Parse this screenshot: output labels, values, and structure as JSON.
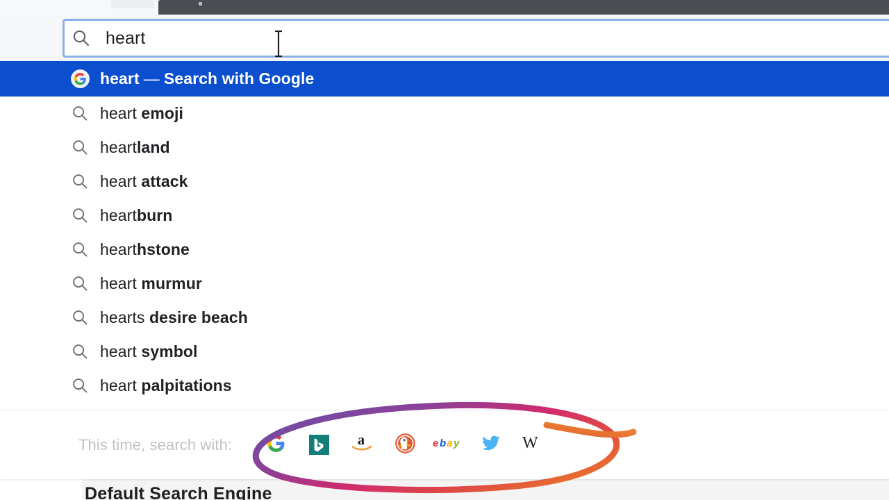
{
  "window": {
    "title_bar_color": "#4a4d52",
    "focus_ring_color": "#8ab0e8"
  },
  "omnibox": {
    "icon": "search-icon",
    "value": "heart",
    "placeholder": "Search or enter address",
    "caret_icon": "text-caret-icon"
  },
  "suggestions": {
    "selected_index": 0,
    "selected_bg": "#0B4ECE",
    "items": [
      {
        "icon": "google-icon",
        "typed": "heart",
        "dash": "—",
        "engine_text": "Search with Google",
        "completion": "",
        "selected": true
      },
      {
        "icon": "search-icon",
        "typed": "heart",
        "completion": " emoji",
        "selected": false
      },
      {
        "icon": "search-icon",
        "typed": "heart",
        "completion": "land",
        "selected": false
      },
      {
        "icon": "search-icon",
        "typed": "heart",
        "completion": " attack",
        "selected": false
      },
      {
        "icon": "search-icon",
        "typed": "heart",
        "completion": "burn",
        "selected": false
      },
      {
        "icon": "search-icon",
        "typed": "heart",
        "completion": "hstone",
        "selected": false
      },
      {
        "icon": "search-icon",
        "typed": "heart",
        "completion": " murmur",
        "selected": false
      },
      {
        "icon": "search-icon",
        "typed": "hearts",
        "completion": " desire beach",
        "selected": false
      },
      {
        "icon": "search-icon",
        "typed": "heart",
        "completion": " symbol",
        "selected": false
      },
      {
        "icon": "search-icon",
        "typed": "heart",
        "completion": " palpitations",
        "selected": false
      }
    ]
  },
  "engine_bar": {
    "label": "This time, search with:",
    "label_color": "#bfc2c6",
    "engines": [
      {
        "name": "Google",
        "icon": "google-icon"
      },
      {
        "name": "Bing",
        "icon": "bing-icon",
        "color": "#147d7a"
      },
      {
        "name": "Amazon",
        "icon": "amazon-icon",
        "color": "#f0a03c"
      },
      {
        "name": "DuckDuckGo",
        "icon": "duckduckgo-icon",
        "color": "#de5833"
      },
      {
        "name": "eBay",
        "icon": "ebay-icon"
      },
      {
        "name": "Twitter",
        "icon": "twitter-icon",
        "color": "#4ab3f4"
      },
      {
        "name": "Wikipedia",
        "icon": "wikipedia-icon",
        "color": "#202122"
      }
    ]
  },
  "page": {
    "heading": "Default Search Engine"
  },
  "annotation": {
    "ellipse_gradient_start": "#6b4fa8",
    "ellipse_gradient_mid": "#cf2a6e",
    "ellipse_gradient_end": "#e8762b",
    "arrow_color": "#e8762b",
    "shape": "ellipse-with-arrow"
  }
}
